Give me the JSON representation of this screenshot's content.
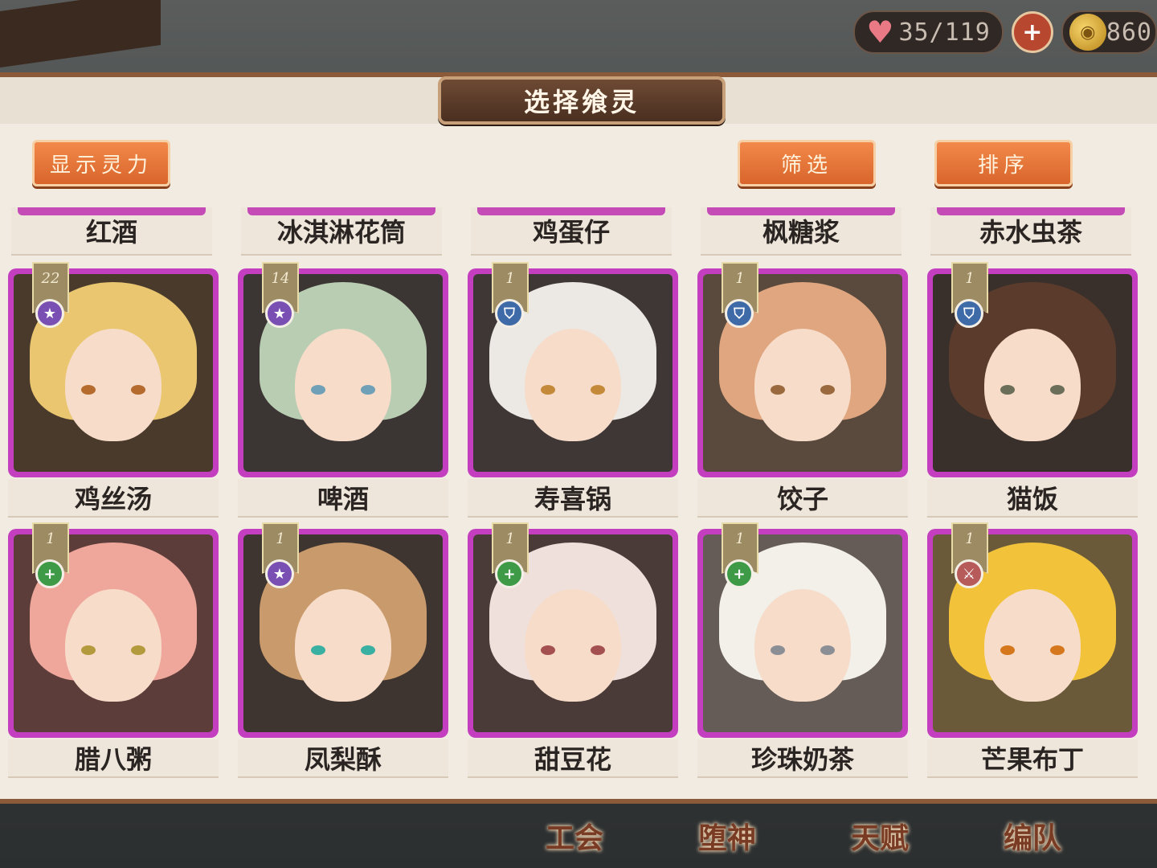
{
  "resources": {
    "stamina": "35/119",
    "coins": "860"
  },
  "dialog": {
    "title": "选择飨灵",
    "show_power_label": "显示灵力",
    "filter_label": "筛选",
    "sort_label": "排序"
  },
  "top_row_names": [
    "红酒",
    "冰淇淋花筒",
    "鸡蛋仔",
    "枫糖浆",
    "赤水虫茶"
  ],
  "cards": [
    {
      "name": "鸡丝汤",
      "level": "22",
      "type": "star",
      "hair": "#e9c66f",
      "bg": "#4a3a2c",
      "eye": "#b56b2d"
    },
    {
      "name": "啤酒",
      "level": "14",
      "type": "star",
      "hair": "#b9cdb3",
      "bg": "#3b3533",
      "eye": "#6fa0b7"
    },
    {
      "name": "寿喜锅",
      "level": "1",
      "type": "shield",
      "hair": "#ece9e4",
      "bg": "#3e3736",
      "eye": "#c48a3a"
    },
    {
      "name": "饺子",
      "level": "1",
      "type": "shield",
      "hair": "#e0a67f",
      "bg": "#5a4a3d",
      "eye": "#9a6a3e"
    },
    {
      "name": "猫饭",
      "level": "1",
      "type": "shield",
      "hair": "#5b3b2c",
      "bg": "#3a302b",
      "eye": "#6b6e58"
    },
    {
      "name": "腊八粥",
      "level": "1",
      "type": "plus",
      "hair": "#f0a79b",
      "bg": "#5c3d3a",
      "eye": "#b39a3c"
    },
    {
      "name": "凤梨酥",
      "level": "1",
      "type": "star",
      "hair": "#c99a6b",
      "bg": "#3f3530",
      "eye": "#3ab0a2"
    },
    {
      "name": "甜豆花",
      "level": "1",
      "type": "plus",
      "hair": "#efe0dc",
      "bg": "#4a3b39",
      "eye": "#a55050"
    },
    {
      "name": "珍珠奶茶",
      "level": "1",
      "type": "plus",
      "hair": "#f3efe9",
      "bg": "#655c57",
      "eye": "#8b8f95"
    },
    {
      "name": "芒果布丁",
      "level": "1",
      "type": "sword",
      "hair": "#f2c33a",
      "bg": "#6a5a3a",
      "eye": "#d5781d"
    }
  ],
  "bottom_nav": [
    "工会",
    "堕神",
    "天赋",
    "编队"
  ],
  "icons": {
    "star": "★",
    "shield": "⛉",
    "plus": "+",
    "sword": "⚔"
  }
}
